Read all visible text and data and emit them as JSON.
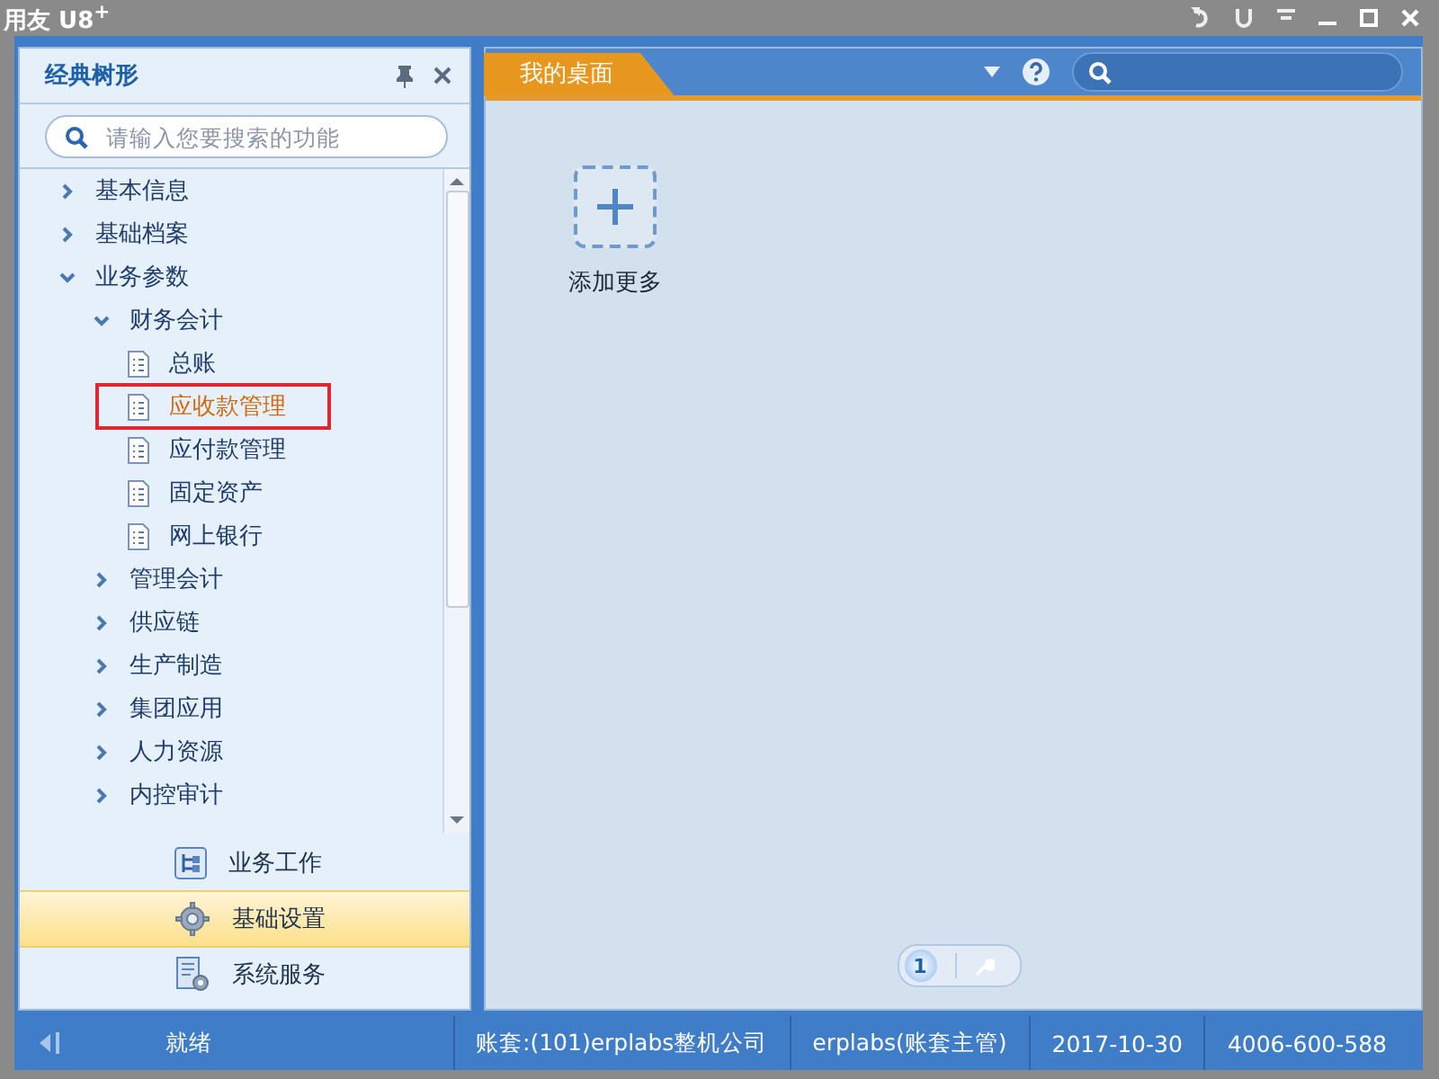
{
  "window": {
    "title": "用友 U8$^{+}$"
  },
  "sidebar": {
    "title": "经典树形",
    "search": {
      "placeholder": "请输入您要搜索的功能"
    },
    "tree": [
      {
        "label": "基本信息",
        "kind": "folder",
        "expanded": false,
        "selected": false
      },
      {
        "label": "基础档案",
        "kind": "folder",
        "expanded": false,
        "selected": false
      },
      {
        "label": "业务参数",
        "kind": "folder",
        "expanded": true,
        "selected": false,
        "children": [
          {
            "label": "财务会计",
            "kind": "folder",
            "expanded": true,
            "selected": false,
            "children": [
              {
                "label": "总账",
                "kind": "document",
                "selected": false
              },
              {
                "label": "应收款管理",
                "kind": "document",
                "selected": true
              },
              {
                "label": "应付款管理",
                "kind": "document",
                "selected": false
              },
              {
                "label": "固定资产",
                "kind": "document",
                "selected": false
              },
              {
                "label": "网上银行",
                "kind": "document",
                "selected": false
              }
            ]
          },
          {
            "label": "管理会计",
            "kind": "folder",
            "expanded": false,
            "selected": false
          },
          {
            "label": "供应链",
            "kind": "folder",
            "expanded": false,
            "selected": false
          },
          {
            "label": "生产制造",
            "kind": "folder",
            "expanded": false,
            "selected": false
          },
          {
            "label": "集团应用",
            "kind": "folder",
            "expanded": false,
            "selected": false
          },
          {
            "label": "人力资源",
            "kind": "folder",
            "expanded": false,
            "selected": false
          },
          {
            "label": "内控审计",
            "kind": "folder",
            "expanded": false,
            "selected": false
          }
        ]
      }
    ],
    "nav": [
      {
        "label": "业务工作",
        "kind": "work",
        "selected": false
      },
      {
        "label": "基础设置",
        "kind": "settings",
        "selected": true
      },
      {
        "label": "系统服务",
        "kind": "service",
        "selected": false
      }
    ]
  },
  "tabs": [
    {
      "label": "我的桌面",
      "selected": true
    }
  ],
  "desktop": {
    "add_label": "添加更多",
    "pager": [
      {
        "label": "1",
        "selected": true
      }
    ]
  },
  "status_bar": {
    "status": "就绪",
    "account": "账套:(101)erplabs整机公司",
    "user": "erplabs(账套主管)",
    "date": "2017-10-30",
    "phone": "4006-600-588"
  }
}
